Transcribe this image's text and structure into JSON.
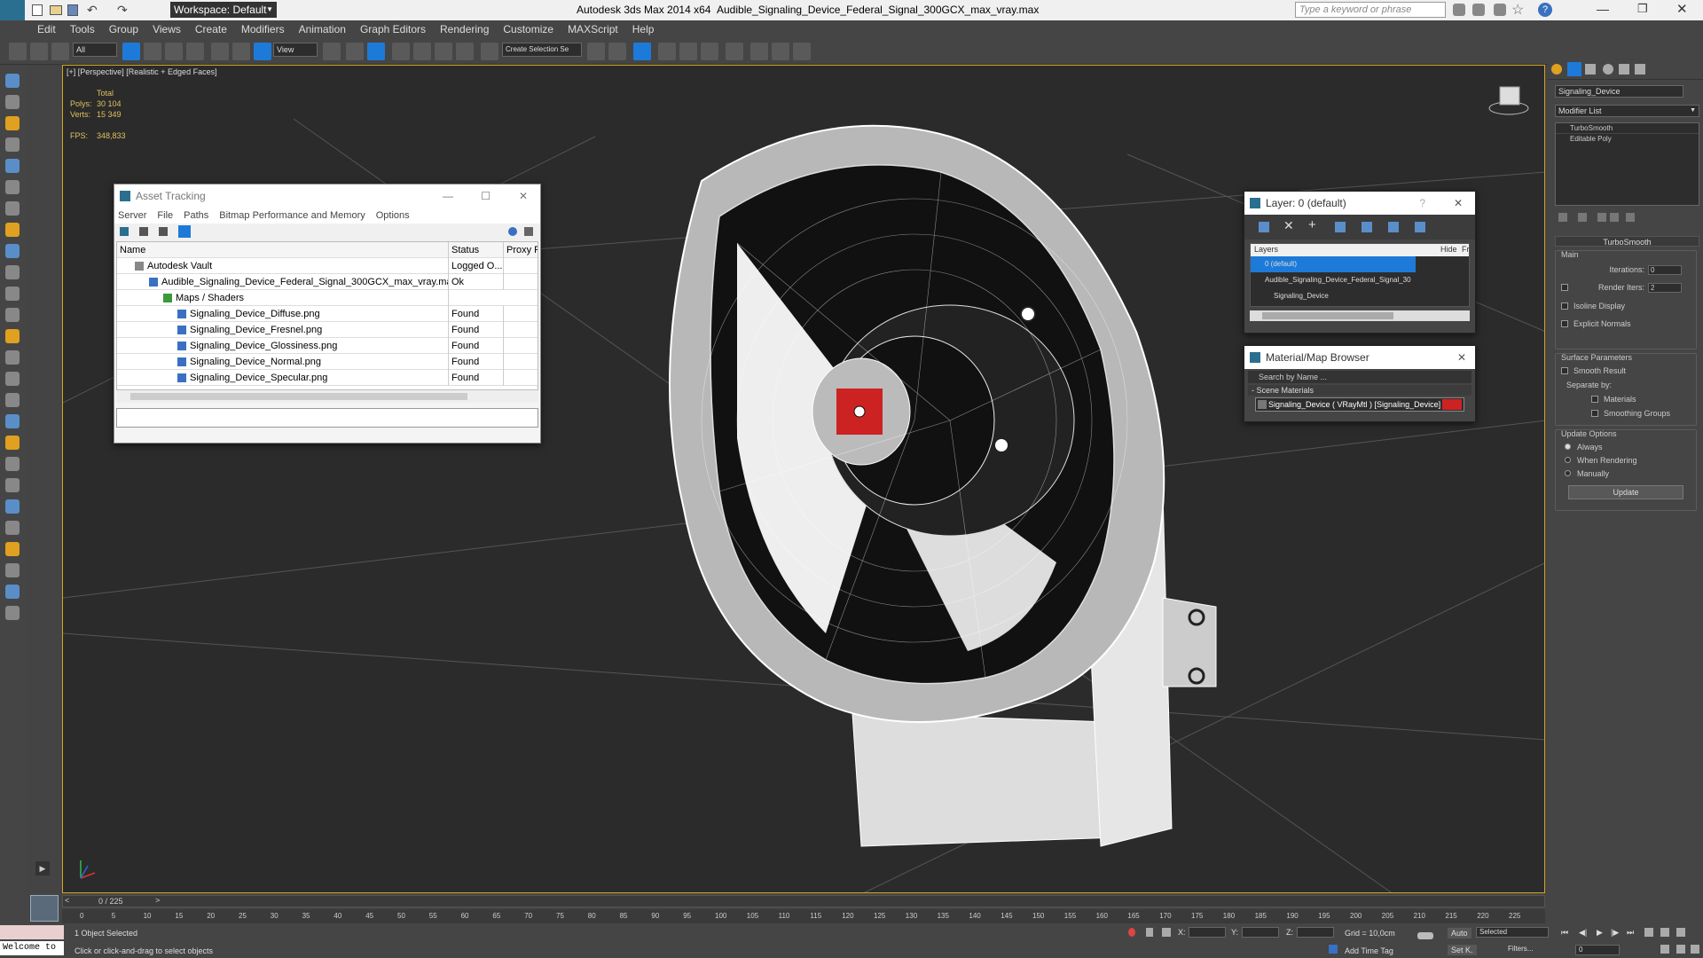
{
  "titlebar": {
    "workspace_label": "Workspace: Default",
    "app_title": "Autodesk 3ds Max  2014 x64",
    "file_title": "Audible_Signaling_Device_Federal_Signal_300GCX_max_vray.max",
    "search_placeholder": "Type a keyword or phrase"
  },
  "menu": [
    "Edit",
    "Tools",
    "Group",
    "Views",
    "Create",
    "Modifiers",
    "Animation",
    "Graph Editors",
    "Rendering",
    "Customize",
    "MAXScript",
    "Help"
  ],
  "toolbar": {
    "selection_filter": "All",
    "ref_coord": "View",
    "named_selection": "Create Selection Se"
  },
  "viewport": {
    "label": "[+] [Perspective] [Realistic + Edged Faces]",
    "stats_total": "Total",
    "polys_label": "Polys:",
    "polys_value": "30 104",
    "verts_label": "Verts:",
    "verts_value": "15 349",
    "fps_label": "FPS:",
    "fps_value": "348,833"
  },
  "asset_tracking": {
    "title": "Asset Tracking",
    "menu": [
      "Server",
      "File",
      "Paths",
      "Bitmap Performance and Memory",
      "Options"
    ],
    "col_name": "Name",
    "col_status": "Status",
    "col_proxy": "Proxy R",
    "rows": [
      {
        "name": "Autodesk Vault",
        "status": "Logged O..."
      },
      {
        "name": "Audible_Signaling_Device_Federal_Signal_300GCX_max_vray.max",
        "status": "Ok"
      },
      {
        "name": "Maps / Shaders",
        "status": ""
      },
      {
        "name": "Signaling_Device_Diffuse.png",
        "status": "Found"
      },
      {
        "name": "Signaling_Device_Fresnel.png",
        "status": "Found"
      },
      {
        "name": "Signaling_Device_Glossiness.png",
        "status": "Found"
      },
      {
        "name": "Signaling_Device_Normal.png",
        "status": "Found"
      },
      {
        "name": "Signaling_Device_Specular.png",
        "status": "Found"
      }
    ]
  },
  "layer_window": {
    "title": "Layer: 0 (default)",
    "col_layers": "Layers",
    "col_hide": "Hide",
    "col_fr": "Fr",
    "rows": [
      "0 (default)",
      "Audible_Signaling_Device_Federal_Signal_30",
      "Signaling_Device"
    ]
  },
  "material_browser": {
    "title": "Material/Map Browser",
    "search_placeholder": "Search by Name ...",
    "section": "- Scene Materials",
    "item": "Signaling_Device ( VRayMtl ) [Signaling_Device]"
  },
  "command_panel": {
    "object_name": "Signaling_Device",
    "modifier_list": "Modifier List",
    "stack": [
      "TurboSmooth",
      "Editable Poly"
    ],
    "rollout_title": "TurboSmooth",
    "main_label": "Main",
    "iterations_label": "Iterations:",
    "iterations_value": "0",
    "render_iters_label": "Render Iters:",
    "render_iters_value": "2",
    "isoline_label": "Isoline Display",
    "explicit_label": "Explicit Normals",
    "surface_label": "Surface Parameters",
    "smooth_result_label": "Smooth Result",
    "separate_by_label": "Separate by:",
    "materials_label": "Materials",
    "smoothing_label": "Smoothing Groups",
    "update_options_label": "Update Options",
    "always_label": "Always",
    "when_rendering_label": "When Rendering",
    "manually_label": "Manually",
    "update_button": "Update"
  },
  "timeline": {
    "frame_display": "0 / 225",
    "ticks": [
      "0",
      "5",
      "10",
      "15",
      "20",
      "25",
      "30",
      "35",
      "40",
      "45",
      "50",
      "55",
      "60",
      "65",
      "70",
      "75",
      "80",
      "85",
      "90",
      "95",
      "100",
      "105",
      "110",
      "115",
      "120",
      "125",
      "130",
      "135",
      "140",
      "145",
      "150",
      "155",
      "160",
      "165",
      "170",
      "175",
      "180",
      "185",
      "190",
      "195",
      "200",
      "205",
      "210",
      "215",
      "220",
      "225"
    ]
  },
  "status": {
    "maxscript": "Welcome to",
    "selected": "1 Object Selected",
    "prompt": "Click or click-and-drag to select objects",
    "x_label": "X:",
    "y_label": "Y:",
    "z_label": "Z:",
    "grid": "Grid = 10,0cm",
    "add_time_tag": "Add Time Tag",
    "auto": "Auto",
    "set_k": "Set K.",
    "selected_dropdown": "Selected",
    "filters": "Filters...",
    "frame": "0"
  },
  "colors": {
    "viewport_bg": "#2b2b2b",
    "ui_bg": "#454545",
    "selection_blue": "#1e7ad8",
    "highlight_yellow": "#d8a420",
    "red_material": "#cc2222"
  }
}
